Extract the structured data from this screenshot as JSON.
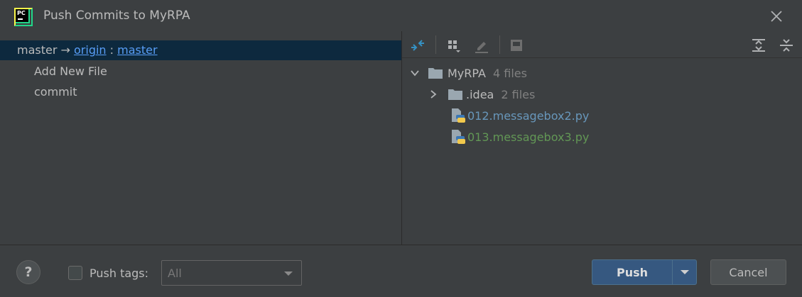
{
  "window": {
    "title": "Push Commits to MyRPA",
    "app_logo_text": "PC"
  },
  "left": {
    "repo": {
      "local_branch": "master",
      "arrow": "→",
      "remote": "origin",
      "separator": ":",
      "remote_branch": "master"
    },
    "commits": [
      "Add New File",
      "commit"
    ]
  },
  "toolbar": {
    "icons": [
      "expand-collapse-diff-icon",
      "group-by-icon",
      "edit-source-icon",
      "show-diff-icon",
      "expand-all-icon",
      "collapse-all-icon"
    ]
  },
  "tree": {
    "root": {
      "name": "MyRPA",
      "count": "4 files"
    },
    "folder": {
      "name": ".idea",
      "count": "2 files"
    },
    "files": [
      {
        "name": "012.messagebox2.py",
        "color": "#6897bb"
      },
      {
        "name": "013.messagebox3.py",
        "color": "#629755"
      }
    ]
  },
  "bottom": {
    "help_label": "?",
    "push_tags_label": "Push tags:",
    "push_tags_value": "All",
    "push_label": "Push",
    "cancel_label": "Cancel"
  },
  "colors": {
    "accent": "#365880",
    "link": "#589df6",
    "selection": "#0d293e"
  }
}
